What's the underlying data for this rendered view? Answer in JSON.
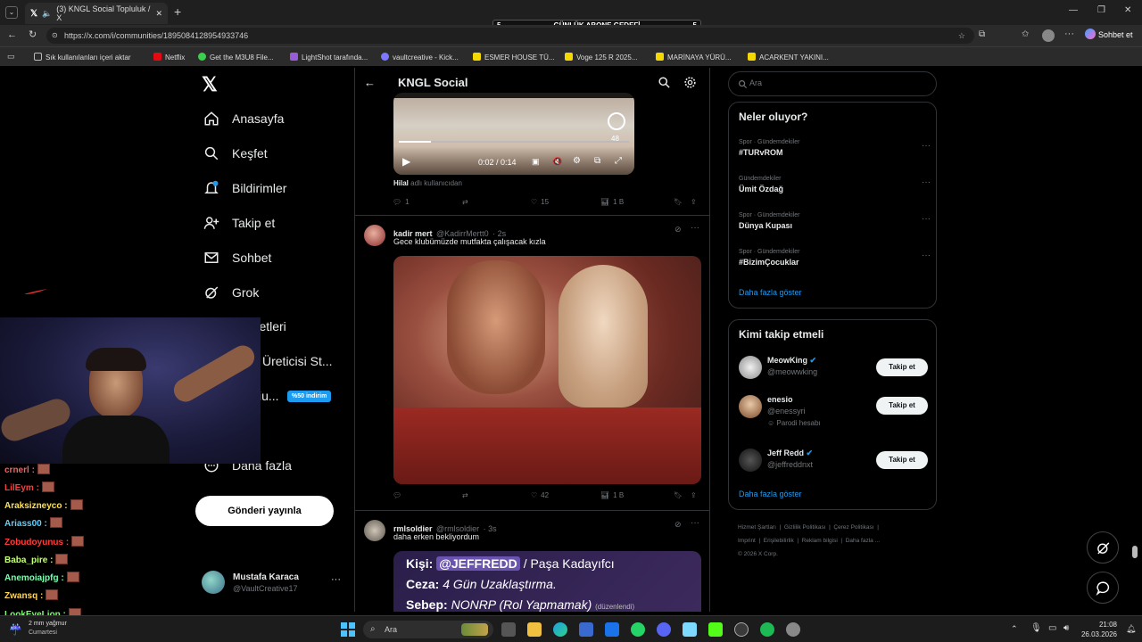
{
  "browser": {
    "tab_title": "(3) KNGL Social Topluluk / X",
    "url": "https://x.com/i/communities/1895084128954933746",
    "banner": {
      "left": "5",
      "text": "GÜNLÜK ABONE GEDEFİ",
      "right": "5"
    },
    "profile_label": "Sohbet et",
    "bookmarks": [
      "Sık kullanılanları içeri aktar",
      "Netflix",
      "Get the M3U8 File...",
      "LightShot tarafında...",
      "vaultcreative - Kick...",
      "ESMER HOUSE TÜ...",
      "Voge 125 R 2025...",
      "MARİNAYA YÜRÜ...",
      "ACARKENT YAKINI..."
    ]
  },
  "colors": {
    "accent": "#1d9bf0",
    "background": "#000000",
    "border": "#2f3336"
  },
  "nav": {
    "items": [
      {
        "label": "Anasayfa",
        "icon": "home-icon"
      },
      {
        "label": "Keşfet",
        "icon": "search-icon"
      },
      {
        "label": "Bildirimler",
        "icon": "bell-icon",
        "badge": "3"
      },
      {
        "label": "Takip et",
        "icon": "follow-icon"
      },
      {
        "label": "Sohbet",
        "icon": "mail-icon"
      },
      {
        "label": "Grok",
        "icon": "grok-icon"
      },
      {
        "label": "aretleri",
        "icon": "bookmark-icon"
      },
      {
        "label": "Üreticisi St...",
        "icon": "creator-icon"
      },
      {
        "label": "iu...",
        "icon": "premium-icon"
      },
      {
        "label": "Daha fazla",
        "icon": "more-icon"
      }
    ],
    "premium_badge": "%50 indirim",
    "post_button": "Gönderi yayınla",
    "profile": {
      "name": "Mustafa Karaca",
      "handle": "@VaultCreative17"
    }
  },
  "feed": {
    "header_title": "KNGL Social",
    "tweets": [
      {
        "video": {
          "time": "0:02 / 0:14",
          "overlay_count": "48"
        },
        "footer_name": "Hilal",
        "footer_note": "adlı kullanıcıdan",
        "replies": "1",
        "reposts": "",
        "likes": "15",
        "views": "1 B"
      },
      {
        "name": "kadir mert",
        "handle": "@KadirrMertt0",
        "time": "· 2s",
        "text": "Gece klubümüzde mutfakta çalışacak kızla",
        "replies": "",
        "reposts": "",
        "likes": "42",
        "views": "1 B"
      },
      {
        "name": "rmlsoldier",
        "handle": "@rmlsoldier",
        "time": "· 3s",
        "text": "daha erken bekliyordum",
        "card_lines": [
          {
            "label": "Kişi:",
            "value": "@JEFFREDD",
            "rest": "/ Paşa Kadayıfcı"
          },
          {
            "label": "Ceza:",
            "value": "4 Gün Uzaklaştırma.",
            "rest": ""
          },
          {
            "label": "Sebep:",
            "value": "NONRP (Rol Yapmamak)",
            "rest": "(düzenlendi)"
          }
        ]
      }
    ]
  },
  "right": {
    "search_placeholder": "Ara",
    "trends_title": "Neler oluyor?",
    "trends": [
      {
        "meta": "Spor · Gündemdekiler",
        "title": "#TURvROM"
      },
      {
        "meta": "Gündemdekiler",
        "title": "Ümit Özdağ"
      },
      {
        "meta": "Spor · Gündemdekiler",
        "title": "Dünya Kupası"
      },
      {
        "meta": "Spor · Gündemdekiler",
        "title": "#BizimÇocuklar"
      }
    ],
    "show_more": "Daha fazla göster",
    "who_title": "Kimi takip etmeli",
    "who": [
      {
        "name": "MeowKing",
        "handle": "@meowwking",
        "note": "",
        "button": "Takip et"
      },
      {
        "name": "enesio",
        "handle": "@enessyri",
        "note": "Parodi hesabı",
        "button": "Takip et"
      },
      {
        "name": "Jeff Redd",
        "handle": "@jeffreddnxt",
        "note": "",
        "button": "Takip et"
      }
    ],
    "footer_links": [
      "Hizmet Şartları",
      "Gizlilik Politikası",
      "Çerez Politikası",
      "Imprint",
      "Erişilebilirlik",
      "Reklam bilgisi",
      "Daha fazla ..."
    ],
    "copyright": "© 2026 X Corp."
  },
  "chat": [
    {
      "user": "crnerl :",
      "color": "#ff5c5c"
    },
    {
      "user": "LilEym :",
      "color": "#ff3c3c"
    },
    {
      "user": "Araksizneyco :",
      "color": "#ffe14a"
    },
    {
      "user": "Ariass00 :",
      "color": "#5cd1ff"
    },
    {
      "user": "Zobudoyunus :",
      "color": "#ff3c3c"
    },
    {
      "user": "Baba_pire :",
      "color": "#c6ff7a"
    },
    {
      "user": "Anemoiajpfg :",
      "color": "#7affb0"
    },
    {
      "user": "Zwansq :",
      "color": "#ffd65c"
    },
    {
      "user": "LookEyeLion :",
      "color": "#7aff6e"
    }
  ],
  "taskbar": {
    "search": "Ara",
    "weather_temp": "2 mm yağmur",
    "weather_day": "Cumartesi",
    "time": "21:08",
    "date": "26.03.2026"
  }
}
